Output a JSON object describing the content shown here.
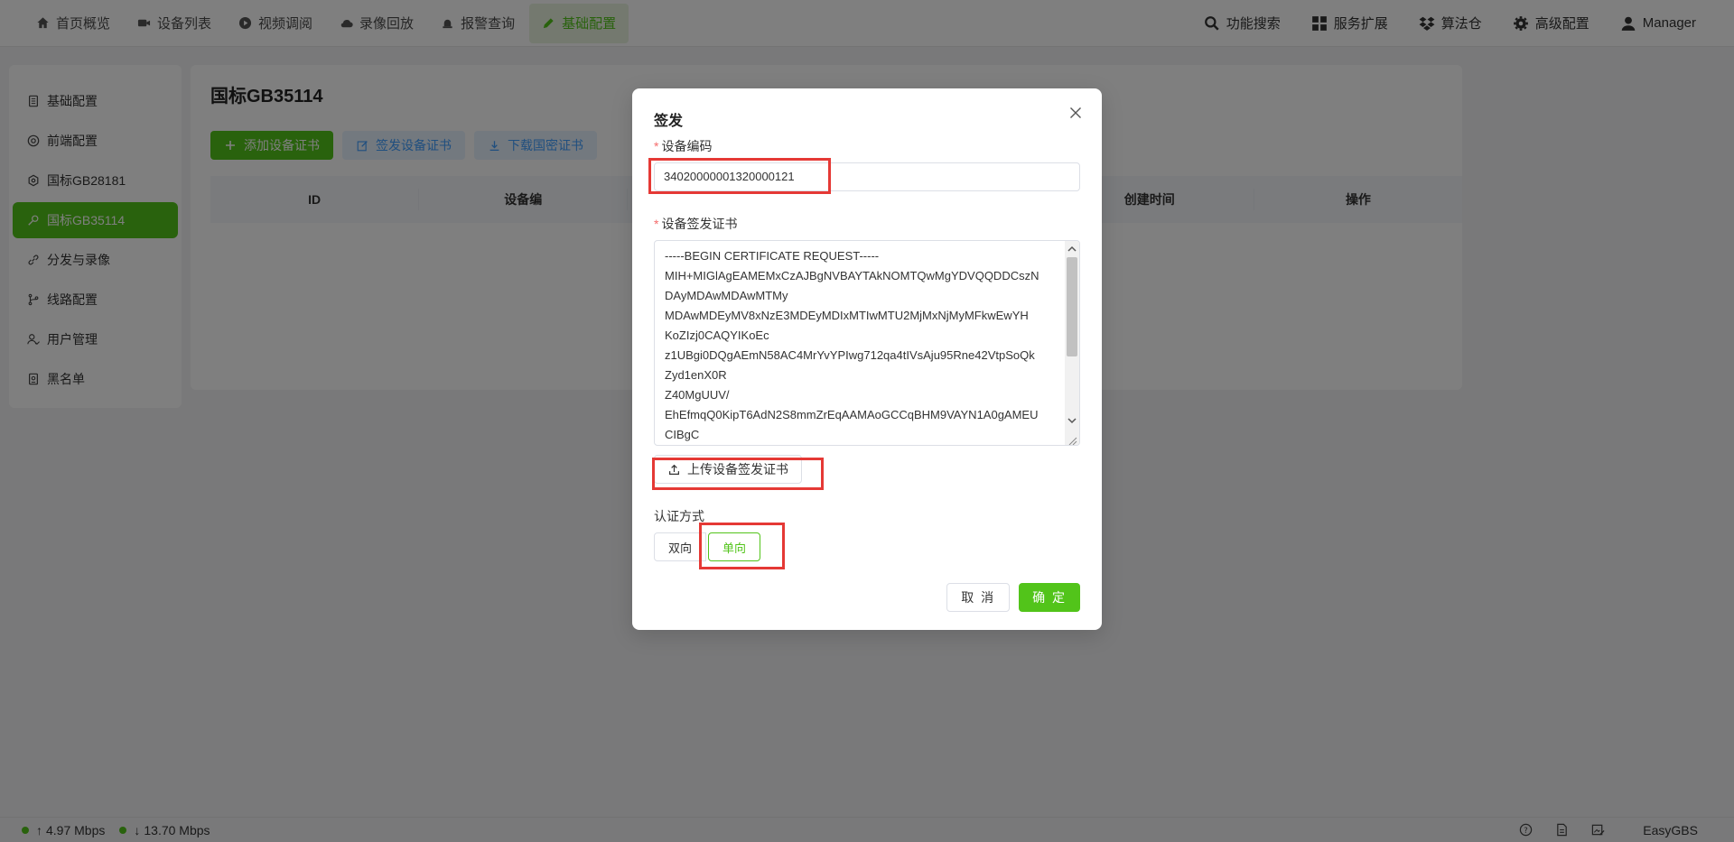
{
  "colors": {
    "accent": "#52c41a",
    "highlight": "#e53935"
  },
  "topnav": {
    "items": [
      {
        "label": "首页概览",
        "icon": "home-icon"
      },
      {
        "label": "设备列表",
        "icon": "camera-icon"
      },
      {
        "label": "视频调阅",
        "icon": "play-circle-icon"
      },
      {
        "label": "录像回放",
        "icon": "cloud-icon"
      },
      {
        "label": "报警查询",
        "icon": "alarm-icon"
      },
      {
        "label": "基础配置",
        "icon": "edit-icon",
        "active": true
      }
    ],
    "right": [
      {
        "label": "功能搜索",
        "icon": "search-icon"
      },
      {
        "label": "服务扩展",
        "icon": "apps-icon"
      },
      {
        "label": "算法仓",
        "icon": "dropbox-icon"
      },
      {
        "label": "高级配置",
        "icon": "gear-icon"
      },
      {
        "label": "Manager",
        "icon": "user-icon"
      }
    ]
  },
  "sidebar": {
    "items": [
      {
        "label": "基础配置",
        "icon": "doc-icon"
      },
      {
        "label": "前端配置",
        "icon": "chrome-icon"
      },
      {
        "label": "国标GB28181",
        "icon": "settings-icon"
      },
      {
        "label": "国标GB35114",
        "icon": "key-icon",
        "active": true
      },
      {
        "label": "分发与录像",
        "icon": "link-icon"
      },
      {
        "label": "线路配置",
        "icon": "branch-icon"
      },
      {
        "label": "用户管理",
        "icon": "users-icon"
      },
      {
        "label": "黑名单",
        "icon": "blacklist-icon"
      }
    ]
  },
  "main": {
    "title": "国标GB35114",
    "buttons": {
      "add": "添加设备证书",
      "sign": "签发设备证书",
      "download": "下载国密证书"
    },
    "table": {
      "columns": [
        "ID",
        "设备编",
        "",
        "",
        "创建时间",
        "操作"
      ]
    }
  },
  "status": {
    "up": "4.97 Mbps",
    "down": "13.70 Mbps",
    "brand": "EasyGBS"
  },
  "dialog": {
    "title": "签发",
    "device_code_label": "设备编码",
    "device_code_value": "34020000001320000121",
    "cert_label": "设备签发证书",
    "cert_lines": [
      "-----BEGIN CERTIFICATE REQUEST-----",
      "MIH+MIGlAgEAMEMxCzAJBgNVBAYTAkNOMTQwMgYDVQQDDCszN",
      "DAyMDAwMDAwMTMy",
      "MDAwMDEyMV8xNzE3MDEyMDIxMTIwMTU2MjMxNjMyMFkwEwYH",
      "KoZIzj0CAQYIKoEc",
      "z1UBgi0DQgAEmN58AC4MrYvYPIwg712qa4tIVsAju95Rne42VtpSoQk",
      "Zyd1enX0R",
      "Z40MgUUV/",
      "EhEfmqQ0KipT6AdN2S8mmZrEqAAMAoGCCqBHM9VAYN1A0gAMEU",
      "CIBgC"
    ],
    "upload_label": "上传设备签发证书",
    "auth_label": "认证方式",
    "auth_options": [
      "双向",
      "单向"
    ],
    "auth_selected": "单向",
    "cancel_label": "取 消",
    "ok_label": "确 定"
  }
}
